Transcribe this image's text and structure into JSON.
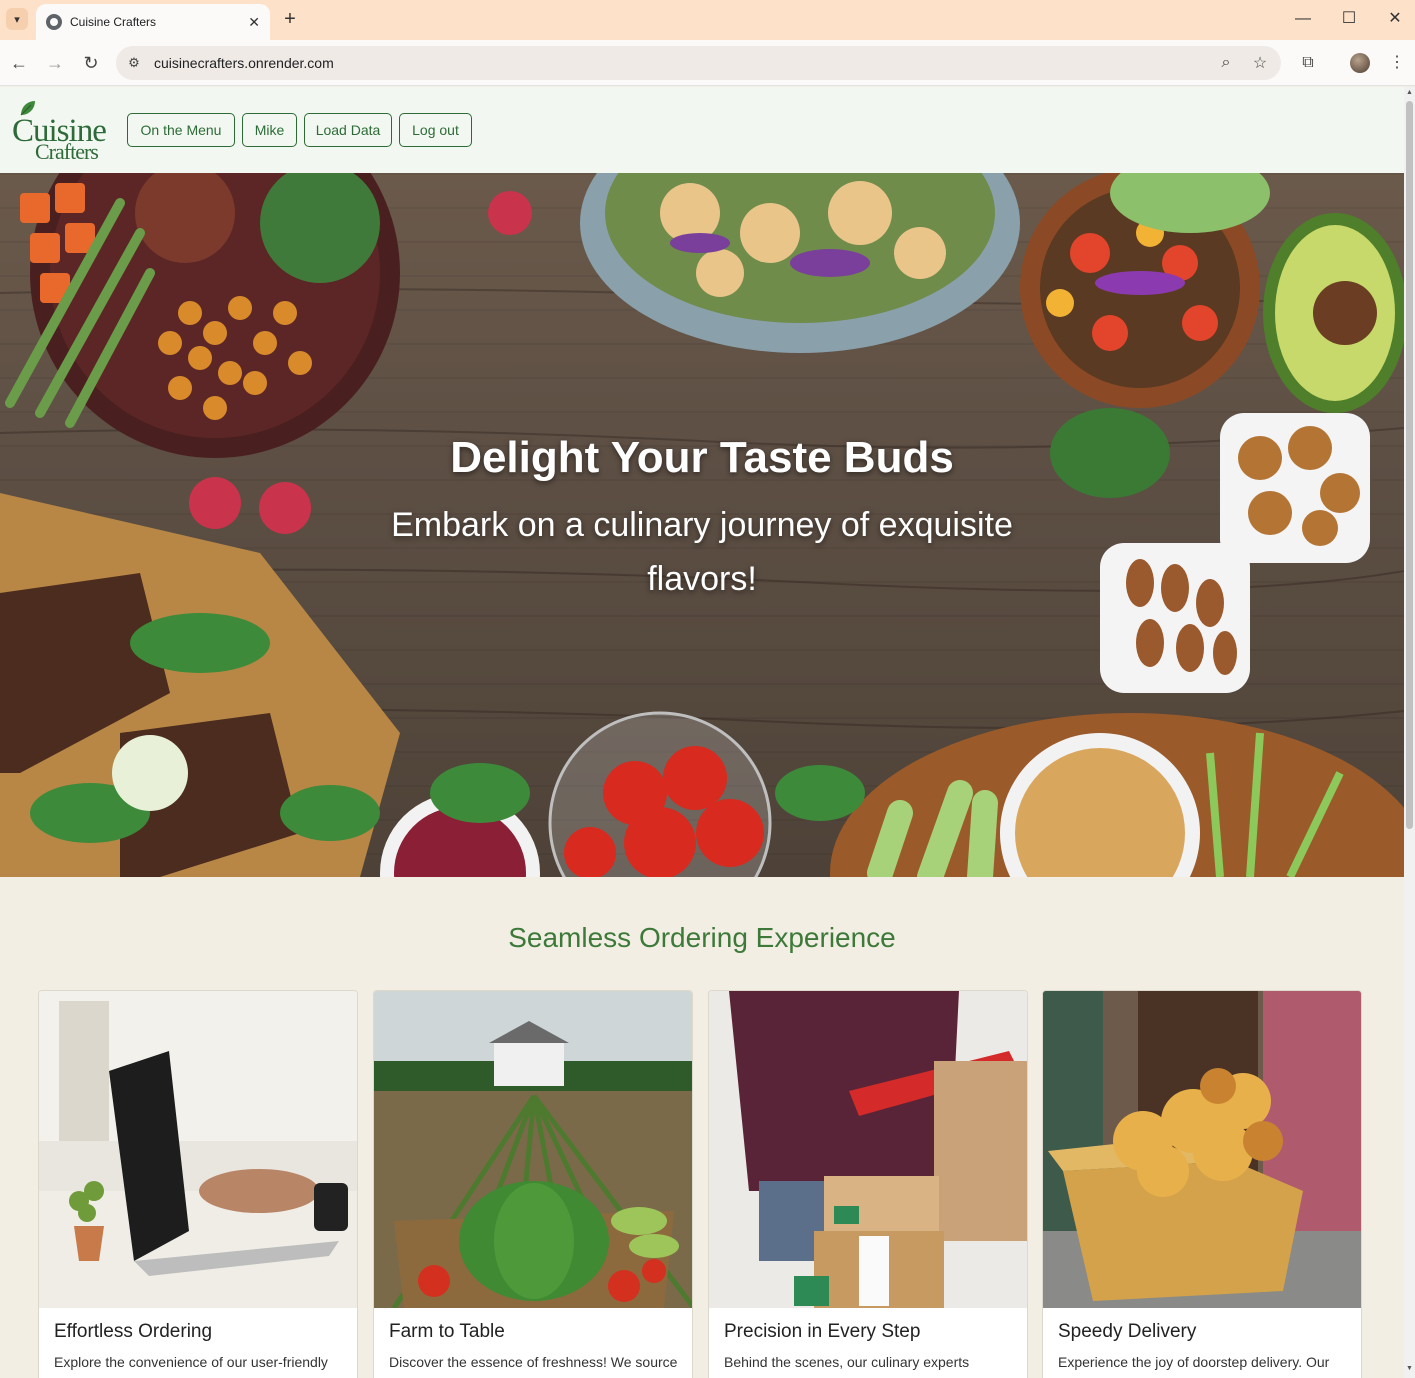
{
  "browser": {
    "tab_title": "Cuisine Crafters",
    "url": "cuisinecrafters.onrender.com",
    "new_tab": "+",
    "tab_close": "✕",
    "minimize": "—",
    "maximize": "☐",
    "close": "✕"
  },
  "header": {
    "logo_line1": "Cuisine",
    "logo_line2": "Crafters",
    "nav": [
      "On the Menu",
      "Mike",
      "Load Data",
      "Log out"
    ]
  },
  "hero": {
    "title": "Delight Your Taste Buds",
    "subtitle": "Embark on a culinary journey of exquisite flavors!"
  },
  "features": {
    "title": "Seamless Ordering Experience",
    "cards": [
      {
        "title": "Effortless Ordering",
        "text": "Explore the convenience of our user-friendly"
      },
      {
        "title": "Farm to Table",
        "text": "Discover the essence of freshness! We source"
      },
      {
        "title": "Precision in Every Step",
        "text": "Behind the scenes, our culinary experts"
      },
      {
        "title": "Speedy Delivery",
        "text": "Experience the joy of doorstep delivery. Our"
      }
    ]
  },
  "colors": {
    "brand_green": "#2d6b36",
    "section_title": "#3d7a3a",
    "header_bg": "#f2f8f1",
    "page_bg": "#f3eee3",
    "tab_strip": "#fde1c8"
  }
}
